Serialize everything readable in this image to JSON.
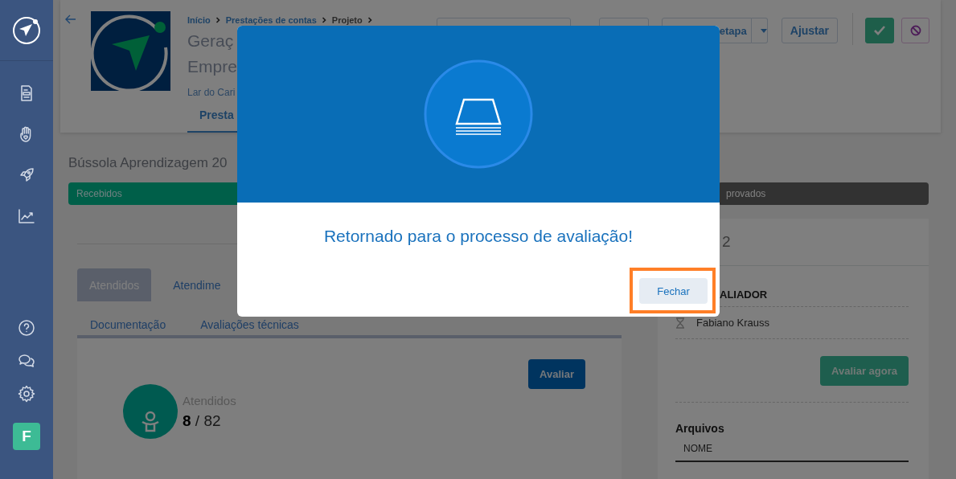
{
  "header": {
    "breadcrumb": [
      "Início",
      "Prestações de contas",
      "Projeto"
    ],
    "title_lines": [
      "Geraç",
      "Empre"
    ],
    "subtitle": "Lar do Cari",
    "tabs": [
      {
        "label": "Presta",
        "selected": true
      }
    ],
    "actions": [
      {
        "kind": "blank"
      },
      {
        "kind": "blank"
      },
      {
        "kind": "split",
        "label": "etapa"
      },
      {
        "kind": "plain",
        "label": "Ajustar"
      },
      {
        "kind": "approve"
      },
      {
        "kind": "reject"
      }
    ]
  },
  "section": {
    "title": "Bússola Aprendizagem 20",
    "stages": [
      {
        "label": "Recebidos",
        "kind": "done"
      },
      {
        "label": "provados",
        "kind": "pending"
      }
    ]
  },
  "left_panel": {
    "tabs": [
      {
        "label": "Atendidos",
        "selected": true
      },
      {
        "label": "Atendime",
        "selected": false
      },
      {
        "label": "Documentação",
        "selected": false
      },
      {
        "label": "Avaliações técnicas",
        "selected": false
      }
    ],
    "evaluate_button": "Avaliar",
    "stat": {
      "label": "Atendidos",
      "count": "8",
      "total": "/ 82"
    }
  },
  "right_panel": {
    "heading": "2",
    "evaluator_heading": "ALIADOR",
    "evaluators": [
      {
        "name": "Fabiano Krauss",
        "pending": true
      }
    ],
    "evaluate_button": "Avaliar agora",
    "files_heading": "Arquivos",
    "files_columns": [
      "NOME"
    ]
  },
  "user": {
    "initial": "F"
  },
  "dialog": {
    "message": "Retornado para o processo de avaliação!",
    "buttons": [
      {
        "label": "Fechar",
        "highlighted": true
      }
    ]
  }
}
